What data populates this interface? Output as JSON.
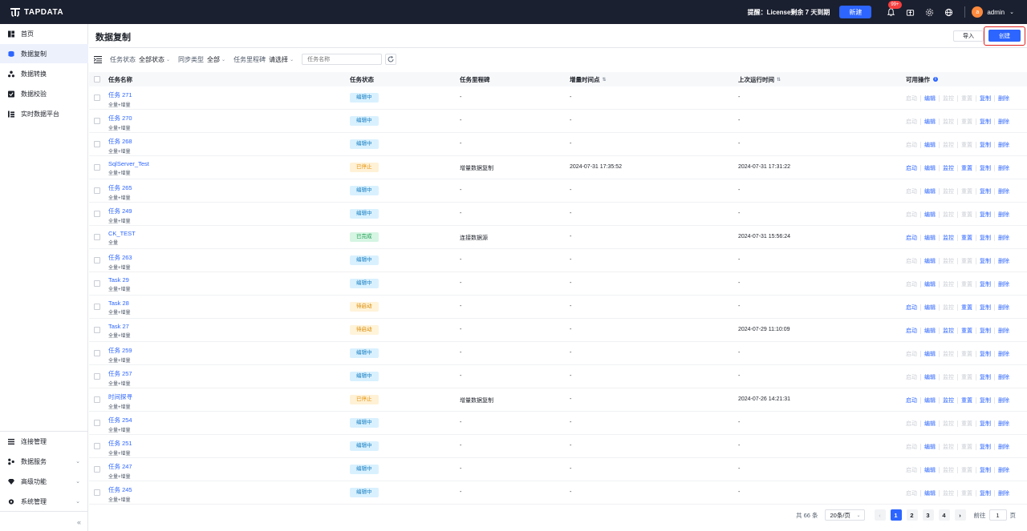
{
  "topbar": {
    "brand": "TAPDATA",
    "license_notice": "提醒：License剩余 7 天到期",
    "new_label": "新建",
    "notification_badge": "99+",
    "user_initial": "a",
    "username": "admin"
  },
  "sidebar": {
    "items": [
      {
        "label": "首页",
        "icon": "dashboard-icon"
      },
      {
        "label": "数据复制",
        "icon": "database-icon"
      },
      {
        "label": "数据转换",
        "icon": "nodes-icon"
      },
      {
        "label": "数据校验",
        "icon": "verify-icon"
      },
      {
        "label": "实时数据平台",
        "icon": "platform-icon"
      }
    ],
    "bottom_items": [
      {
        "label": "连接管理",
        "icon": "connection-icon"
      },
      {
        "label": "数据服务",
        "icon": "service-icon"
      },
      {
        "label": "高级功能",
        "icon": "diamond-icon"
      },
      {
        "label": "系统管理",
        "icon": "gear-icon"
      }
    ],
    "collapse": "«"
  },
  "page": {
    "title": "数据复制",
    "import_label": "导入",
    "create_label": "创建"
  },
  "filters": {
    "status_label": "任务状态",
    "status_value": "全部状态",
    "sync_label": "同步类型",
    "sync_value": "全部",
    "milestone_label": "任务里程碑",
    "milestone_value": "请选择",
    "search_placeholder": "任务名称"
  },
  "table": {
    "headers": {
      "name": "任务名称",
      "status": "任务状态",
      "milestone": "任务里程碑",
      "incr_time": "增量时间点",
      "last_run": "上次运行时间",
      "ops": "可用操作"
    },
    "op_labels": [
      "启动",
      "编辑",
      "监控",
      "重置",
      "复制",
      "删除"
    ],
    "rows": [
      {
        "name": "任务 271",
        "type": "全量+增量",
        "status": "编辑中",
        "milestone": "-",
        "incr": "-",
        "last": "-",
        "ops": [
          0,
          1,
          0,
          0,
          1,
          1
        ]
      },
      {
        "name": "任务 270",
        "type": "全量+增量",
        "status": "编辑中",
        "milestone": "-",
        "incr": "-",
        "last": "-",
        "ops": [
          0,
          1,
          0,
          0,
          1,
          1
        ]
      },
      {
        "name": "任务 268",
        "type": "全量+增量",
        "status": "编辑中",
        "milestone": "-",
        "incr": "-",
        "last": "-",
        "ops": [
          0,
          1,
          0,
          0,
          1,
          1
        ]
      },
      {
        "name": "SqlServer_Test",
        "type": "全量+增量",
        "status": "已停止",
        "milestone": "增量数据复制",
        "incr": "2024-07-31 17:35:52",
        "last": "2024-07-31 17:31:22",
        "ops": [
          1,
          1,
          1,
          1,
          1,
          1
        ]
      },
      {
        "name": "任务 265",
        "type": "全量+增量",
        "status": "编辑中",
        "milestone": "-",
        "incr": "-",
        "last": "-",
        "ops": [
          0,
          1,
          0,
          0,
          1,
          1
        ]
      },
      {
        "name": "任务 249",
        "type": "全量+增量",
        "status": "编辑中",
        "milestone": "-",
        "incr": "-",
        "last": "-",
        "ops": [
          0,
          1,
          0,
          0,
          1,
          1
        ]
      },
      {
        "name": "CK_TEST",
        "type": "全量",
        "status": "已完成",
        "milestone": "连接数据源",
        "incr": "-",
        "last": "2024-07-31 15:56:24",
        "ops": [
          1,
          1,
          1,
          1,
          1,
          1
        ]
      },
      {
        "name": "任务 263",
        "type": "全量+增量",
        "status": "编辑中",
        "milestone": "-",
        "incr": "-",
        "last": "-",
        "ops": [
          0,
          1,
          0,
          0,
          1,
          1
        ]
      },
      {
        "name": "Task 29",
        "type": "全量+增量",
        "status": "编辑中",
        "milestone": "-",
        "incr": "-",
        "last": "-",
        "ops": [
          0,
          1,
          0,
          0,
          1,
          1
        ]
      },
      {
        "name": "Task 28",
        "type": "全量+增量",
        "status": "待启动",
        "milestone": "-",
        "incr": "-",
        "last": "-",
        "ops": [
          1,
          1,
          0,
          1,
          1,
          1
        ]
      },
      {
        "name": "Task 27",
        "type": "全量+增量",
        "status": "待启动",
        "milestone": "-",
        "incr": "-",
        "last": "2024-07-29 11:10:09",
        "ops": [
          1,
          1,
          1,
          1,
          1,
          1
        ]
      },
      {
        "name": "任务 259",
        "type": "全量+增量",
        "status": "编辑中",
        "milestone": "-",
        "incr": "-",
        "last": "-",
        "ops": [
          0,
          1,
          0,
          0,
          1,
          1
        ]
      },
      {
        "name": "任务 257",
        "type": "全量+增量",
        "status": "编辑中",
        "milestone": "-",
        "incr": "-",
        "last": "-",
        "ops": [
          0,
          1,
          0,
          0,
          1,
          1
        ]
      },
      {
        "name": "时间探寻",
        "type": "全量+增量",
        "status": "已停止",
        "milestone": "增量数据复制",
        "incr": "-",
        "last": "2024-07-26 14:21:31",
        "ops": [
          1,
          1,
          1,
          1,
          1,
          1
        ]
      },
      {
        "name": "任务 254",
        "type": "全量+增量",
        "status": "编辑中",
        "milestone": "-",
        "incr": "-",
        "last": "-",
        "ops": [
          0,
          1,
          0,
          0,
          1,
          1
        ]
      },
      {
        "name": "任务 251",
        "type": "全量+增量",
        "status": "编辑中",
        "milestone": "-",
        "incr": "-",
        "last": "-",
        "ops": [
          0,
          1,
          0,
          0,
          1,
          1
        ]
      },
      {
        "name": "任务 247",
        "type": "全量+增量",
        "status": "编辑中",
        "milestone": "-",
        "incr": "-",
        "last": "-",
        "ops": [
          0,
          1,
          0,
          0,
          1,
          1
        ]
      },
      {
        "name": "任务 245",
        "type": "全量+增量",
        "status": "编辑中",
        "milestone": "-",
        "incr": "-",
        "last": "-",
        "ops": [
          0,
          1,
          0,
          0,
          1,
          1
        ]
      }
    ]
  },
  "status_colors": {
    "编辑中": {
      "bg": "#d9f1ff",
      "fg": "#1a7fc1"
    },
    "已停止": {
      "bg": "#fff1d6",
      "fg": "#e69512"
    },
    "已完成": {
      "bg": "#d6f5e3",
      "fg": "#1f9e52"
    },
    "待启动": {
      "bg": "#fff3d9",
      "fg": "#d98a00"
    }
  },
  "colors": {
    "accent": "#2c65ff",
    "disabled": "#c9cdd4"
  },
  "pagination": {
    "total": "共 66 条",
    "page_size": "20条/页",
    "pages": [
      "1",
      "2",
      "3",
      "4"
    ],
    "current": "1",
    "goto_label": "前往",
    "goto_value": "1",
    "goto_unit": "页"
  }
}
